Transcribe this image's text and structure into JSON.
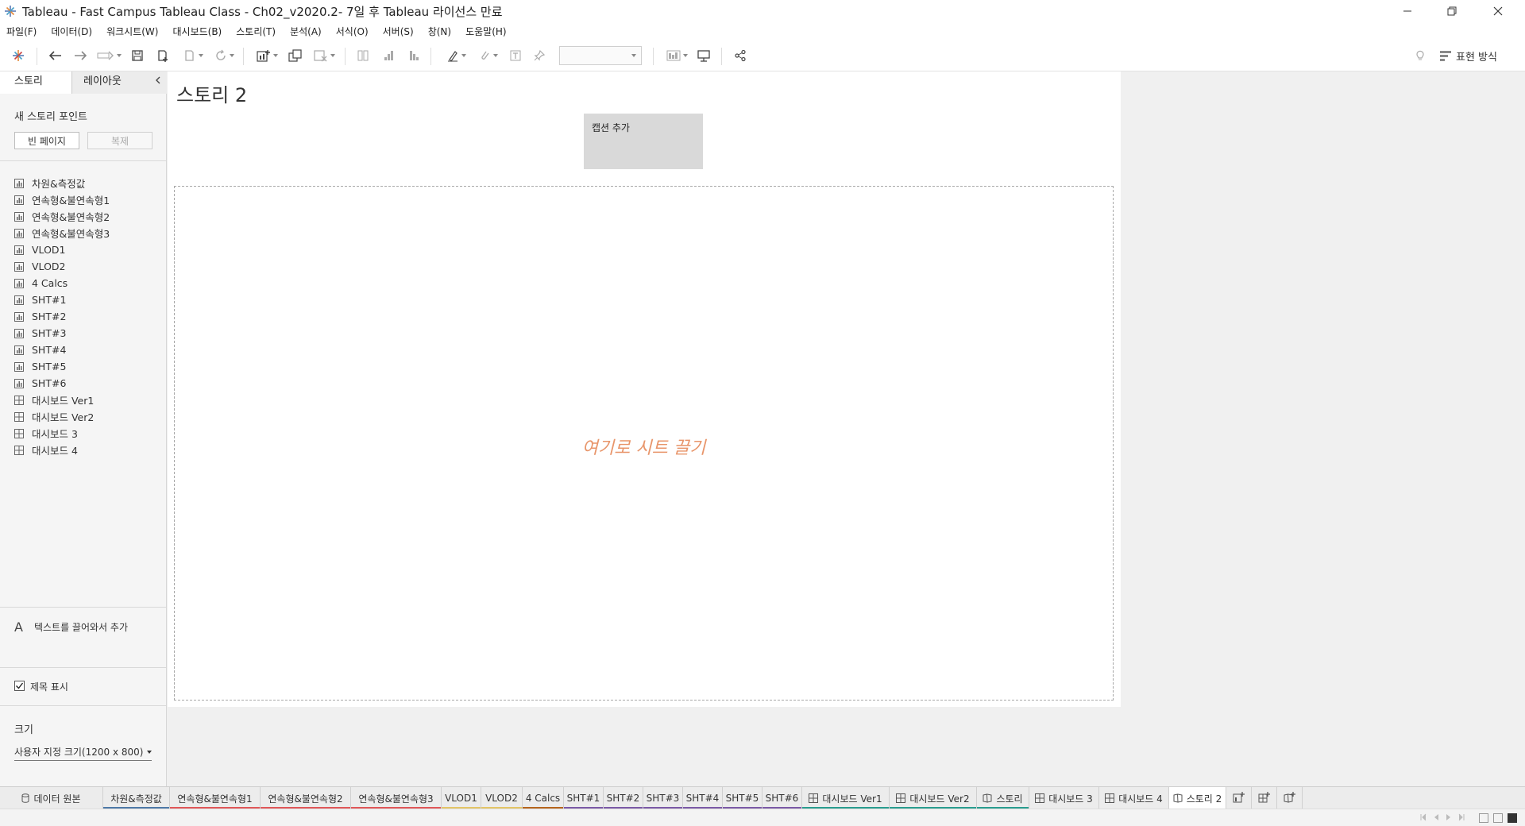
{
  "window": {
    "title": "Tableau - Fast Campus Tableau Class - Ch02_v2020.2- 7일 후 Tableau 라이선스 만료"
  },
  "menu": [
    "파일(F)",
    "데이터(D)",
    "워크시트(W)",
    "대시보드(B)",
    "스토리(T)",
    "분석(A)",
    "서식(O)",
    "서버(S)",
    "창(N)",
    "도움말(H)"
  ],
  "toolbar": {
    "show_me_label": "표현 방식"
  },
  "left_panel": {
    "tabs": {
      "story": "스토리",
      "layout": "레이아웃"
    },
    "new_story_point_label": "새 스토리 포인트",
    "blank_button": "빈 페이지",
    "duplicate_button": "복제",
    "sheets": [
      {
        "name": "차원&측정값",
        "icon": "worksheet-icon"
      },
      {
        "name": "연속형&불연속형1",
        "icon": "worksheet-icon"
      },
      {
        "name": "연속형&불연속형2",
        "icon": "worksheet-icon"
      },
      {
        "name": "연속형&불연속형3",
        "icon": "worksheet-icon"
      },
      {
        "name": "VLOD1",
        "icon": "worksheet-icon"
      },
      {
        "name": "VLOD2",
        "icon": "worksheet-icon"
      },
      {
        "name": "4 Calcs",
        "icon": "worksheet-icon"
      },
      {
        "name": "SHT#1",
        "icon": "worksheet-icon"
      },
      {
        "name": "SHT#2",
        "icon": "worksheet-icon"
      },
      {
        "name": "SHT#3",
        "icon": "worksheet-icon"
      },
      {
        "name": "SHT#4",
        "icon": "worksheet-icon"
      },
      {
        "name": "SHT#5",
        "icon": "worksheet-icon"
      },
      {
        "name": "SHT#6",
        "icon": "worksheet-icon"
      },
      {
        "name": "대시보드 Ver1",
        "icon": "dashboard-icon"
      },
      {
        "name": "대시보드 Ver2",
        "icon": "dashboard-icon"
      },
      {
        "name": "대시보드 3",
        "icon": "dashboard-icon"
      },
      {
        "name": "대시보드 4",
        "icon": "dashboard-icon"
      }
    ],
    "text_drag_icon": "A",
    "text_drag_label": "텍스트를 끌어와서 추가",
    "show_title_label": "제목 표시",
    "show_title_checked": true,
    "size_label": "크기",
    "size_value": "사용자 지정 크기(1200 x 800)"
  },
  "story": {
    "title": "스토리 2",
    "caption_placeholder": "캡션 추가",
    "drop_hint": "여기로 시트 끌기"
  },
  "sheet_tabs": [
    {
      "label": "데이터 원본",
      "icon": "datasource-icon",
      "color": ""
    },
    {
      "label": "차원&측정값",
      "icon": "",
      "color": "#4e79a7"
    },
    {
      "label": "연속형&불연속형1",
      "icon": "",
      "color": "#e15759"
    },
    {
      "label": "연속형&불연속형2",
      "icon": "",
      "color": "#e15759"
    },
    {
      "label": "연속형&불연속형3",
      "icon": "",
      "color": "#e15759"
    },
    {
      "label": "VLOD1",
      "icon": "",
      "color": "#e3c567"
    },
    {
      "label": "VLOD2",
      "icon": "",
      "color": "#e3c567"
    },
    {
      "label": "4 Calcs",
      "icon": "",
      "color": "#b5651d"
    },
    {
      "label": "SHT#1",
      "icon": "",
      "color": "#7b5aa6"
    },
    {
      "label": "SHT#2",
      "icon": "",
      "color": "#7b5aa6"
    },
    {
      "label": "SHT#3",
      "icon": "",
      "color": "#7b5aa6"
    },
    {
      "label": "SHT#4",
      "icon": "",
      "color": "#7b5aa6"
    },
    {
      "label": "SHT#5",
      "icon": "",
      "color": "#7b5aa6"
    },
    {
      "label": "SHT#6",
      "icon": "",
      "color": "#7b5aa6"
    },
    {
      "label": "대시보드 Ver1",
      "icon": "dashboard-icon",
      "color": "#2a9d8f"
    },
    {
      "label": "대시보드 Ver2",
      "icon": "dashboard-icon",
      "color": "#2a9d8f"
    },
    {
      "label": "스토리",
      "icon": "story-icon",
      "color": "#2a9d8f"
    },
    {
      "label": "대시보드 3",
      "icon": "dashboard-icon",
      "color": ""
    },
    {
      "label": "대시보드 4",
      "icon": "dashboard-icon",
      "color": ""
    },
    {
      "label": "스토리 2",
      "icon": "story-icon",
      "color": "",
      "active": true
    }
  ],
  "colors": {
    "drop_hint": "#e8956a",
    "caption_bg": "#d9d9d9",
    "accent_blue": "#4e79a7",
    "accent_red": "#e15759"
  }
}
